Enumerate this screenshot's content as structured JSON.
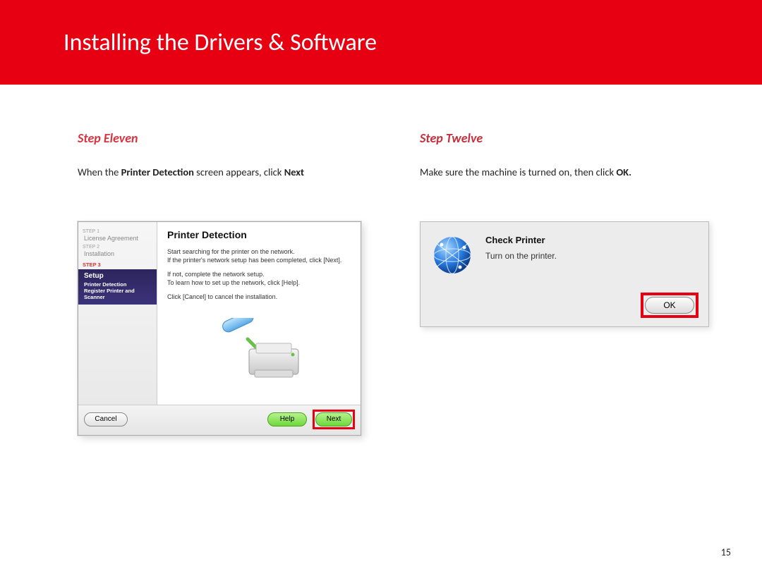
{
  "page_title": "Installing  the Drivers & Software",
  "page_number": "15",
  "step_eleven": {
    "heading": "Step Eleven",
    "text_pre": "When the ",
    "text_bold1": "Printer Detection",
    "text_mid": " screen appears, click ",
    "text_bold2": "Next"
  },
  "step_twelve": {
    "heading": "Step Twelve",
    "text_pre": "Make sure the machine is turned on, then click ",
    "text_bold": "OK.",
    "dialog_title": "Check Printer",
    "dialog_msg": "Turn on the printer.",
    "ok_label": "OK"
  },
  "wizard": {
    "sidebar": {
      "step1_tag": "STEP 1",
      "step1_item": "License Agreement",
      "step2_tag": "STEP 2",
      "step2_item": "Installation",
      "step3_tag": "STEP 3",
      "setup_title": "Setup",
      "setup_sub": "Printer Detection\nRegister Printer and\nScanner"
    },
    "panel": {
      "title": "Printer Detection",
      "line1": "Start searching for the printer on the network.\nIf the printer's network setup has been completed, click [Next].",
      "line2": "If not, complete the network setup.\nTo learn how to set up the network, click [Help].",
      "line3": "Click [Cancel] to cancel the installation."
    },
    "buttons": {
      "cancel": "Cancel",
      "help": "Help",
      "next": "Next"
    }
  }
}
